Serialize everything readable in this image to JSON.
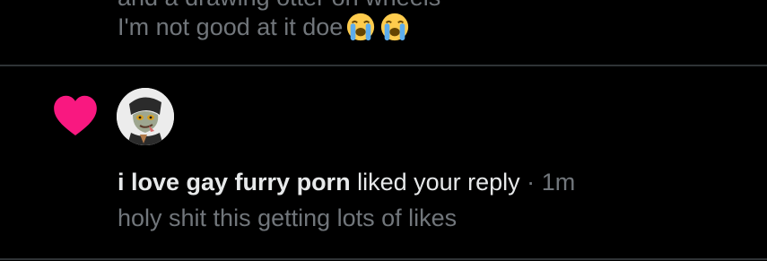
{
  "previous_notification": {
    "partial_text": "and a drawing otter on wheels",
    "text": "I'm not good at it doe",
    "emojis": [
      "loudly-crying-face-icon",
      "loudly-crying-face-icon"
    ]
  },
  "notification": {
    "type_icon": "heart-icon",
    "avatar": "avatar-icon",
    "username": "i love gay furry porn",
    "action": "liked your reply",
    "separator": "·",
    "time": "1m",
    "reply_snippet": "holy shit this getting lots of likes"
  },
  "colors": {
    "background": "#000000",
    "primary_text": "#e7e9ea",
    "secondary_text": "#71767b",
    "like_heart": "#f91880",
    "divider": "#2f3336"
  }
}
